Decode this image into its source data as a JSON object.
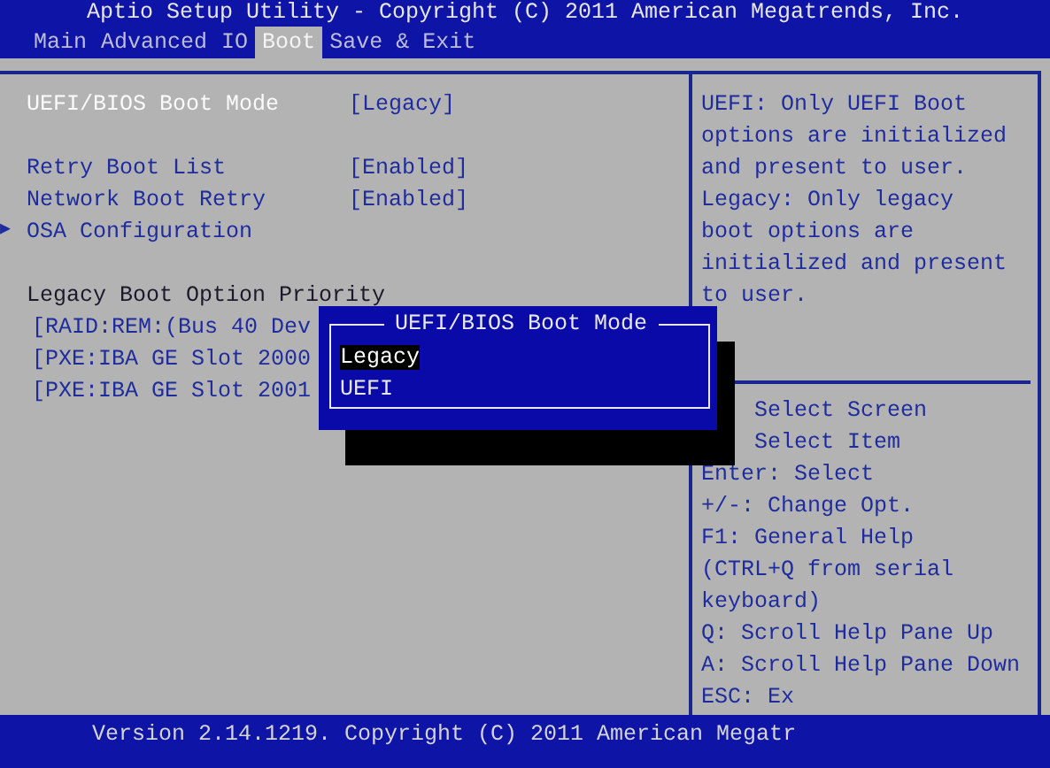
{
  "title": "Aptio Setup Utility - Copyright (C) 2011 American Megatrends, Inc.",
  "tabs": [
    {
      "label": "Main",
      "selected": false
    },
    {
      "label": "Advanced",
      "selected": false
    },
    {
      "label": "IO",
      "selected": false
    },
    {
      "label": "Boot",
      "selected": true
    },
    {
      "label": "Save & Exit",
      "selected": false
    }
  ],
  "items": [
    {
      "kind": "setting",
      "label": "UEFI/BIOS Boot Mode",
      "value": "[Legacy]",
      "selected": true
    },
    {
      "kind": "gap"
    },
    {
      "kind": "setting",
      "label": "Retry Boot List",
      "value": "[Enabled]",
      "selected": false
    },
    {
      "kind": "setting",
      "label": "Network Boot Retry",
      "value": "[Enabled]",
      "selected": false
    },
    {
      "kind": "submenu",
      "label": "OSA Configuration",
      "marker": "▶",
      "selected": false
    },
    {
      "kind": "gap"
    },
    {
      "kind": "heading",
      "label": "Legacy Boot Option Priority"
    },
    {
      "kind": "option",
      "label": "[RAID:REM:(Bus 40 Dev",
      "selected": false
    },
    {
      "kind": "option",
      "label": "[PXE:IBA GE Slot 2000",
      "selected": false
    },
    {
      "kind": "option",
      "label": "[PXE:IBA GE Slot 2001",
      "selected": false
    }
  ],
  "help": {
    "text": [
      "UEFI: Only UEFI Boot",
      "options are initialized",
      "and present to user.",
      "Legacy: Only legacy",
      "boot options are",
      "initialized and present",
      "to user."
    ],
    "keys": [
      {
        "kind": "indented",
        "text": "Select Screen"
      },
      {
        "kind": "indented",
        "text": "Select Item"
      },
      {
        "kind": "plain",
        "text": "Enter: Select"
      },
      {
        "kind": "plain",
        "text": "+/-: Change Opt."
      },
      {
        "kind": "plain",
        "text": "F1: General Help"
      },
      {
        "kind": "plain",
        "text": "(CTRL+Q from serial"
      },
      {
        "kind": "plain",
        "text": "keyboard)"
      },
      {
        "kind": "plain",
        "text": "Q: Scroll Help Pane Up"
      },
      {
        "kind": "plain",
        "text": "A: Scroll Help Pane Down"
      },
      {
        "kind": "plain",
        "text": "ESC: Ex"
      }
    ]
  },
  "popup": {
    "title": "UEFI/BIOS Boot Mode",
    "options": [
      {
        "label": "Legacy",
        "selected": true
      },
      {
        "label": "UEFI",
        "selected": false
      }
    ]
  },
  "footer": "Version 2.14.1219. Copyright (C) 2011 American Megatr"
}
